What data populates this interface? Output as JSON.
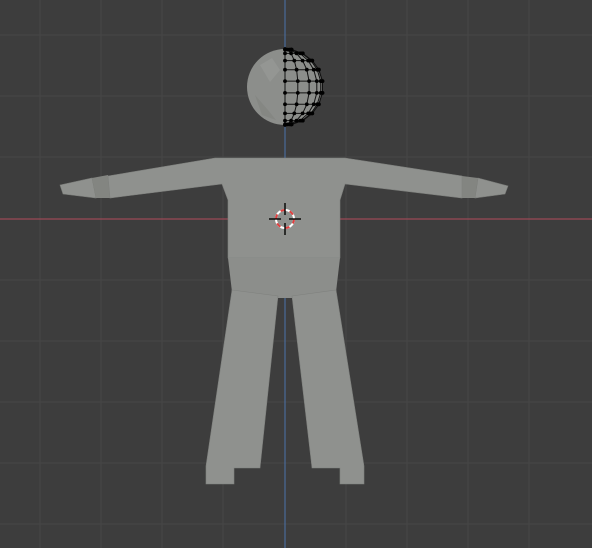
{
  "viewport": {
    "view": "front-orthographic",
    "mode": "edit-mode",
    "grid_visible": true,
    "object": "low-poly-humanoid-t-pose",
    "colors": {
      "background": "#3d3d3d",
      "grid_line": "#474747",
      "x_axis": "#9a4a55",
      "z_axis": "#4a6b9a",
      "mesh_fill": "#8f918e",
      "mesh_shade": "#838581",
      "wire": "#111111",
      "vertex": "#000000",
      "cursor_red": "#e04040",
      "cursor_white": "#ffffff"
    },
    "icons": {
      "cursor": "3d-cursor-icon"
    }
  }
}
